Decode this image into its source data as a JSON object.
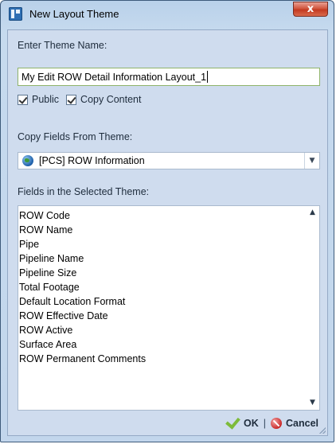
{
  "window": {
    "title": "New Layout Theme",
    "close_glyph": "x"
  },
  "theme_name": {
    "label": "Enter Theme Name:",
    "value": "My Edit ROW Detail Information Layout_1"
  },
  "options": {
    "public_label": "Public",
    "public_checked": true,
    "copy_content_label": "Copy Content",
    "copy_content_checked": true
  },
  "copy_fields": {
    "label": "Copy Fields From Theme:",
    "selected": "[PCS] ROW Information",
    "icon": "globe-icon"
  },
  "fields_list": {
    "label": "Fields in the Selected Theme:",
    "items": [
      "ROW Code",
      "ROW Name",
      "Pipe",
      "Pipeline Name",
      "Pipeline Size",
      "Total Footage",
      "Default Location Format",
      "ROW Effective Date",
      "ROW Active",
      "Surface Area",
      "ROW Permanent Comments"
    ]
  },
  "footer": {
    "ok_label": "OK",
    "separator": "|",
    "cancel_label": "Cancel"
  },
  "colors": {
    "title_bar": "#b9d1ea",
    "close_button": "#c33a21",
    "ok_check": "#7dbb3a",
    "input_focus_border": "#8fb36a"
  }
}
